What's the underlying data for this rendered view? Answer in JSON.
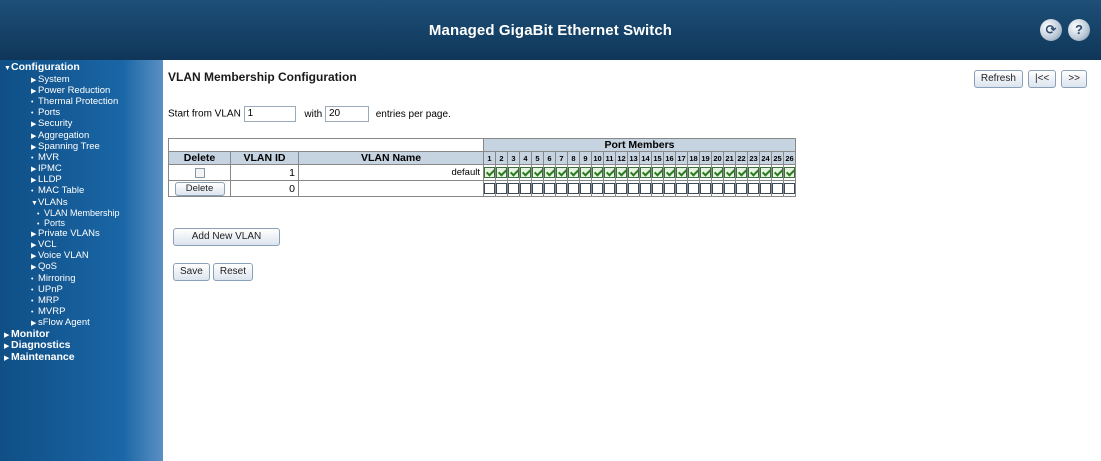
{
  "header": {
    "title": "Managed GigaBit Ethernet Switch",
    "logout_icon": "logout-icon",
    "help_icon": "help-icon"
  },
  "sidebar": {
    "items": [
      {
        "label": "Configuration",
        "level": 0,
        "marker": "▼"
      },
      {
        "label": "System",
        "level": 1,
        "marker": "▶"
      },
      {
        "label": "Power Reduction",
        "level": 1,
        "marker": "▶"
      },
      {
        "label": "Thermal Protection",
        "level": 1,
        "marker": "•"
      },
      {
        "label": "Ports",
        "level": 1,
        "marker": "•"
      },
      {
        "label": "Security",
        "level": 1,
        "marker": "▶"
      },
      {
        "label": "Aggregation",
        "level": 1,
        "marker": "▶"
      },
      {
        "label": "Spanning Tree",
        "level": 1,
        "marker": "▶"
      },
      {
        "label": "MVR",
        "level": 1,
        "marker": "•"
      },
      {
        "label": "IPMC",
        "level": 1,
        "marker": "▶"
      },
      {
        "label": "LLDP",
        "level": 1,
        "marker": "▶"
      },
      {
        "label": "MAC Table",
        "level": 1,
        "marker": "•"
      },
      {
        "label": "VLANs",
        "level": 1,
        "marker": "▼"
      },
      {
        "label": "VLAN Membership",
        "level": 2,
        "marker": "•"
      },
      {
        "label": "Ports",
        "level": 2,
        "marker": "•"
      },
      {
        "label": "Private VLANs",
        "level": 1,
        "marker": "▶"
      },
      {
        "label": "VCL",
        "level": 1,
        "marker": "▶"
      },
      {
        "label": "Voice VLAN",
        "level": 1,
        "marker": "▶"
      },
      {
        "label": "QoS",
        "level": 1,
        "marker": "▶"
      },
      {
        "label": "Mirroring",
        "level": 1,
        "marker": "•"
      },
      {
        "label": "UPnP",
        "level": 1,
        "marker": "•"
      },
      {
        "label": "MRP",
        "level": 1,
        "marker": "•"
      },
      {
        "label": "MVRP",
        "level": 1,
        "marker": "•"
      },
      {
        "label": "sFlow Agent",
        "level": 1,
        "marker": "▶"
      },
      {
        "label": "Monitor",
        "level": 0,
        "marker": "▶"
      },
      {
        "label": "Diagnostics",
        "level": 0,
        "marker": "▶"
      },
      {
        "label": "Maintenance",
        "level": 0,
        "marker": "▶"
      }
    ]
  },
  "main": {
    "title": "VLAN Membership Configuration",
    "refresh_label": "Refresh",
    "first_label": "|<<",
    "next_label": ">>",
    "paging": {
      "prefix": "Start from VLAN",
      "start_value": "1",
      "with": "with",
      "count_value": "20",
      "suffix": "entries per page."
    }
  },
  "table": {
    "group_header": "Port Members",
    "columns": {
      "delete": "Delete",
      "vlan_id": "VLAN ID",
      "vlan_name": "VLAN Name"
    },
    "ports": [
      "1",
      "2",
      "3",
      "4",
      "5",
      "6",
      "7",
      "8",
      "9",
      "10",
      "11",
      "12",
      "13",
      "14",
      "15",
      "16",
      "17",
      "18",
      "19",
      "20",
      "21",
      "22",
      "23",
      "24",
      "25",
      "26"
    ],
    "rows": [
      {
        "vlan_id": "1",
        "vlan_name": "default",
        "members": [
          1,
          1,
          1,
          1,
          1,
          1,
          1,
          1,
          1,
          1,
          1,
          1,
          1,
          1,
          1,
          1,
          1,
          1,
          1,
          1,
          1,
          1,
          1,
          1,
          1,
          1
        ]
      },
      {
        "delete_label": "Delete",
        "vlan_id": "0",
        "vlan_name": "",
        "members": [
          0,
          0,
          0,
          0,
          0,
          0,
          0,
          0,
          0,
          0,
          0,
          0,
          0,
          0,
          0,
          0,
          0,
          0,
          0,
          0,
          0,
          0,
          0,
          0,
          0,
          0
        ]
      }
    ]
  },
  "actions": {
    "add_label": "Add New VLAN",
    "save_label": "Save",
    "reset_label": "Reset"
  }
}
